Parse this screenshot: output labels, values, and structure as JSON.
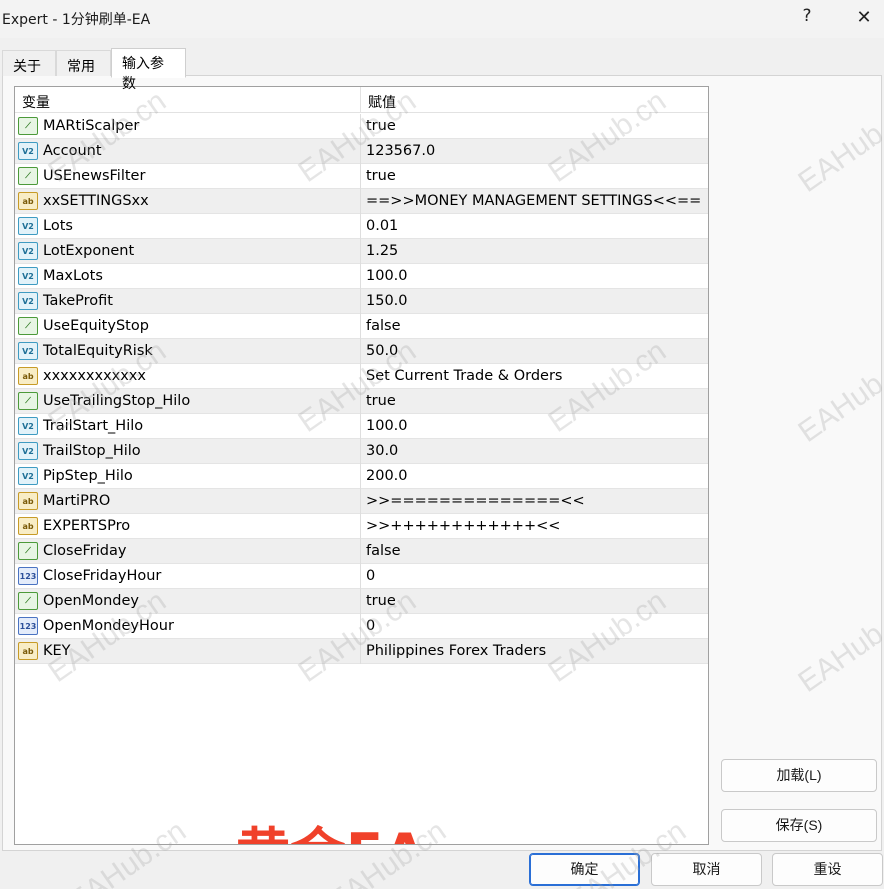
{
  "window": {
    "title": "Expert - 1分钟刷单-EA",
    "help_label": "?",
    "close_label": "✕"
  },
  "tabs": [
    {
      "label": "关于"
    },
    {
      "label": "常用"
    },
    {
      "label": "输入参数"
    }
  ],
  "grid": {
    "header": {
      "variable": "变量",
      "value": "赋值"
    },
    "rows": [
      {
        "type": "bool",
        "icon": "bool-icon",
        "name": "MARtiScalper",
        "value": "true"
      },
      {
        "type": "dbl",
        "icon": "double-icon",
        "name": "Account",
        "value": "123567.0"
      },
      {
        "type": "bool",
        "icon": "bool-icon",
        "name": "USEnewsFilter",
        "value": "true"
      },
      {
        "type": "str",
        "icon": "string-icon",
        "name": "xxSETTINGSxx",
        "value": "==>>MONEY MANAGEMENT SETTINGS<<=="
      },
      {
        "type": "dbl",
        "icon": "double-icon",
        "name": "Lots",
        "value": "0.01"
      },
      {
        "type": "dbl",
        "icon": "double-icon",
        "name": "LotExponent",
        "value": "1.25"
      },
      {
        "type": "dbl",
        "icon": "double-icon",
        "name": "MaxLots",
        "value": "100.0"
      },
      {
        "type": "dbl",
        "icon": "double-icon",
        "name": "TakeProfit",
        "value": "150.0"
      },
      {
        "type": "bool",
        "icon": "bool-icon",
        "name": "UseEquityStop",
        "value": "false"
      },
      {
        "type": "dbl",
        "icon": "double-icon",
        "name": "TotalEquityRisk",
        "value": "50.0"
      },
      {
        "type": "str",
        "icon": "string-icon",
        "name": "xxxxxxxxxxxx",
        "value": "Set Current Trade & Orders"
      },
      {
        "type": "bool",
        "icon": "bool-icon",
        "name": "UseTrailingStop_Hilo",
        "value": "true"
      },
      {
        "type": "dbl",
        "icon": "double-icon",
        "name": "TrailStart_Hilo",
        "value": "100.0"
      },
      {
        "type": "dbl",
        "icon": "double-icon",
        "name": "TrailStop_Hilo",
        "value": "30.0"
      },
      {
        "type": "dbl",
        "icon": "double-icon",
        "name": "PipStep_Hilo",
        "value": "200.0"
      },
      {
        "type": "str",
        "icon": "string-icon",
        "name": "MartiPRO",
        "value": ">>==============<<"
      },
      {
        "type": "str",
        "icon": "string-icon",
        "name": "EXPERTSPro",
        "value": ">>++++++++++++<<"
      },
      {
        "type": "bool",
        "icon": "bool-icon",
        "name": "CloseFriday",
        "value": "false"
      },
      {
        "type": "int",
        "icon": "integer-icon",
        "name": "CloseFridayHour",
        "value": "0"
      },
      {
        "type": "bool",
        "icon": "bool-icon",
        "name": "OpenMondey",
        "value": "true"
      },
      {
        "type": "int",
        "icon": "integer-icon",
        "name": "OpenMondeyHour",
        "value": "0"
      },
      {
        "type": "str",
        "icon": "string-icon",
        "name": "KEY",
        "value": "Philippines Forex Traders"
      }
    ]
  },
  "icon_glyphs": {
    "bool": "⟋",
    "dbl": "V2",
    "str": "ab",
    "int": "123"
  },
  "overlay_text": "黄金EA",
  "watermark": "EAHub.cn",
  "buttons": {
    "load": "加载(L)",
    "save": "保存(S)",
    "ok": "确定",
    "cancel": "取消",
    "reset": "重设"
  },
  "colors": {
    "overlay": "#f0412a",
    "primary_border": "#2a6fd6"
  }
}
